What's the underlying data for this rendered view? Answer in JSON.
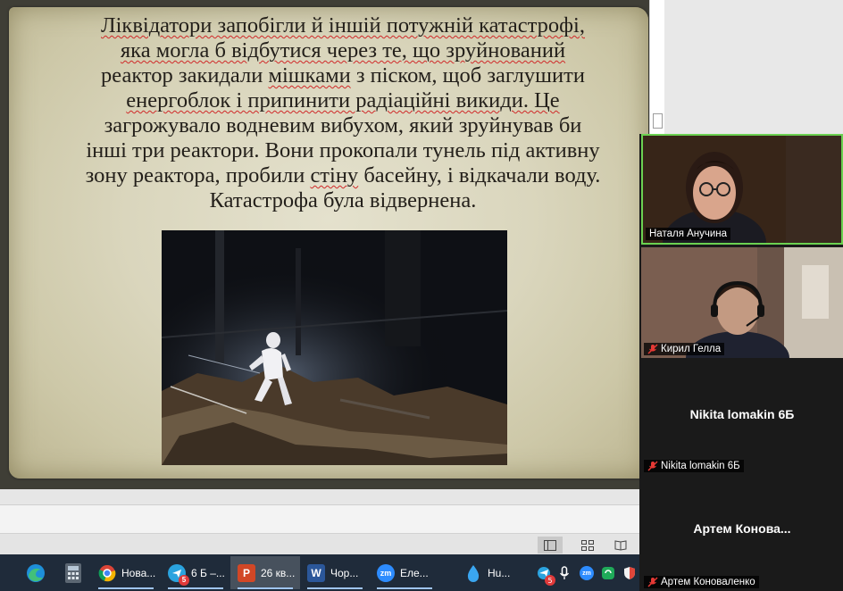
{
  "slide": {
    "lines": [
      [
        "Ліквідатори запобігли й іншій потужній катастрофі,"
      ],
      [
        "яка могла б відбутися через те, що зруйнований"
      ],
      [
        "реактор закидали ",
        "мішками",
        " з піском, щоб заглушити"
      ],
      [
        "енергоблок і припинити радіаційні викиди. Це"
      ],
      [
        "загрожувало водневим вибухом, який зруйнував би"
      ],
      [
        "інші три реактори. Вони прокопали тунель під активну"
      ],
      [
        "зону реактора, пробили ",
        "стіну",
        " басейну, і відкачали воду."
      ],
      [
        "Катастрофа була відвернена."
      ]
    ],
    "photo_alt": "liquidator-in-reactor-ruins"
  },
  "zoom": {
    "participants": [
      {
        "name": "Наталя Анучина",
        "video": true,
        "muted": false
      },
      {
        "name": "Кирил Гелла",
        "video": true,
        "muted": true
      },
      {
        "name": "Nikita lomakin 6Б",
        "video": false,
        "muted": true,
        "display": "Nikita lomakin 6Б"
      },
      {
        "name": "Артем Коноваленко",
        "video": false,
        "muted": true,
        "display": "Артем  Конова..."
      }
    ]
  },
  "taskbar": {
    "apps": [
      {
        "label": "Нова...",
        "icon": "chrome-icon"
      },
      {
        "label": "6 Б –...",
        "icon": "telegram-icon",
        "badge": "5"
      },
      {
        "label": "26 кв...",
        "icon": "powerpoint-icon"
      },
      {
        "label": "Чор...",
        "icon": "word-icon"
      },
      {
        "label": "Еле...",
        "icon": "zoom-icon"
      },
      {
        "label": "Hu...",
        "icon": "water-drop-icon"
      }
    ],
    "tray_badge": "5"
  },
  "colors": {
    "slide_bg": "#3f3e36",
    "parchment": "#dad6bd",
    "zoom_bg": "#1a1a1a",
    "active_speaker": "#6bd151",
    "taskbar": "#1f2b3a"
  }
}
